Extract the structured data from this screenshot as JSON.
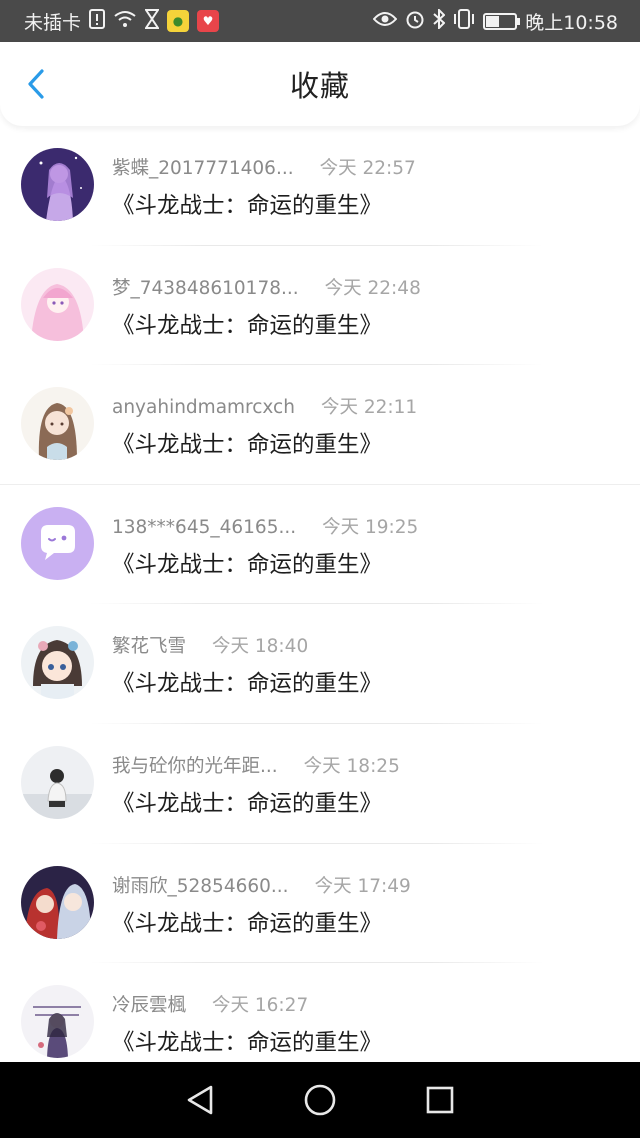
{
  "status_bar": {
    "carrier": "未插卡",
    "time": "晚上10:58",
    "battery_level": 0.45,
    "icons": [
      "sim-alert-icon",
      "wifi-icon",
      "hourglass-icon",
      "app-badge-yellow",
      "app-badge-red",
      "eye-icon",
      "alarm-icon",
      "bluetooth-icon",
      "vibrate-icon",
      "battery-icon"
    ]
  },
  "header": {
    "title": "收藏",
    "back_icon": "chevron-left-icon",
    "accent_color": "#2a9be8"
  },
  "favorites": [
    {
      "name": "紫蝶_2017771406...",
      "time": "今天 22:57",
      "book": "《斗龙战士：命运的重生》",
      "avatar": "purple-anime-girl"
    },
    {
      "name": "梦_743848610178...",
      "time": "今天 22:48",
      "book": "《斗龙战士：命运的重生》",
      "avatar": "pink-anime-girl"
    },
    {
      "name": "anyahindmamrcxch",
      "time": "今天 22:11",
      "book": "《斗龙战士：命运的重生》",
      "avatar": "brown-hair-girl"
    },
    {
      "name": "138***645_46165...",
      "time": "今天 19:25",
      "book": "《斗龙战士：命运的重生》",
      "avatar": "default-chat-bubble"
    },
    {
      "name": "繁花飞雪",
      "time": "今天 18:40",
      "book": "《斗龙战士：命运的重生》",
      "avatar": "chibi-girl"
    },
    {
      "name": "我与砼你的光年距...",
      "time": "今天 18:25",
      "book": "《斗龙战士：命运的重生》",
      "avatar": "person-sitting"
    },
    {
      "name": "谢雨欣_52854660...",
      "time": "今天 17:49",
      "book": "《斗龙战士：命运的重生》",
      "avatar": "two-anime-characters"
    },
    {
      "name": "冷辰雲楓",
      "time": "今天 16:27",
      "book": "《斗龙战士：命运的重生》",
      "avatar": "ink-style-figure"
    }
  ],
  "nav_bar": {
    "icons": [
      "back-triangle-icon",
      "home-circle-icon",
      "recent-square-icon"
    ]
  }
}
